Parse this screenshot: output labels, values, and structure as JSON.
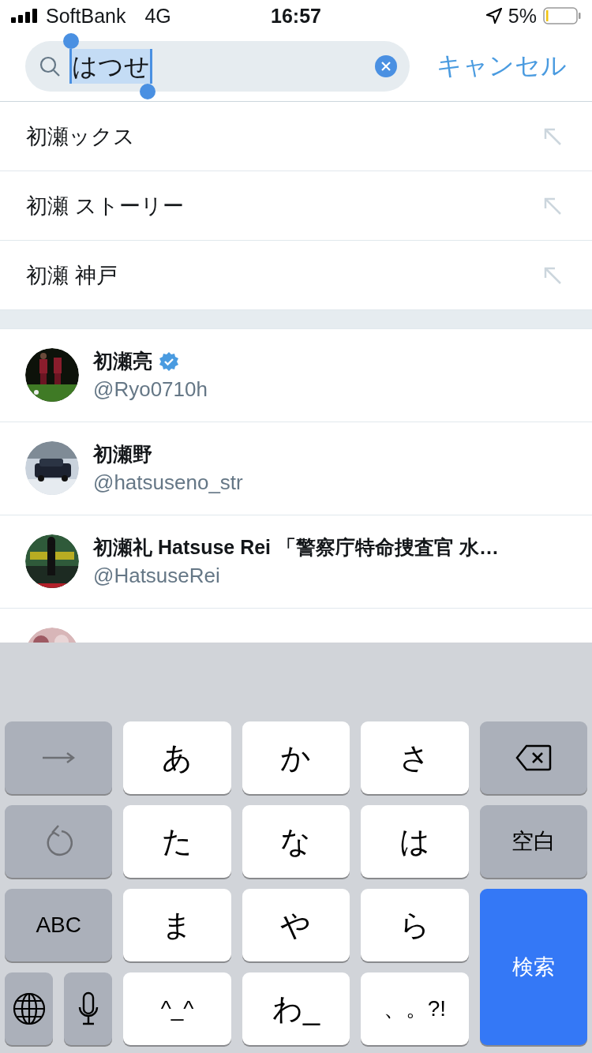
{
  "status_bar": {
    "carrier": "SoftBank",
    "network": "4G",
    "time": "16:57",
    "battery": "5%"
  },
  "search": {
    "value": "はつせ",
    "text_selected": true,
    "cancel": "キャンセル"
  },
  "suggestions": [
    {
      "text": "初瀬ックス"
    },
    {
      "text": "初瀬 ストーリー"
    },
    {
      "text": "初瀬 神戸"
    }
  ],
  "users": [
    {
      "name": "初瀬亮",
      "handle": "@Ryo0710h",
      "verified": true
    },
    {
      "name": "初瀬野",
      "handle": "@hatsuseno_str",
      "verified": false
    },
    {
      "name": "初瀬礼 Hatsuse Rei 「警察庁特命捜査官 水…",
      "handle": "@HatsuseRei",
      "verified": false
    },
    {
      "verified": false
    }
  ],
  "keyboard": {
    "keys": [
      {
        "kind": "next"
      },
      {
        "kind": "char",
        "label": "あ"
      },
      {
        "kind": "char",
        "label": "か"
      },
      {
        "kind": "char",
        "label": "さ"
      },
      {
        "kind": "delete"
      },
      {
        "kind": "undo"
      },
      {
        "kind": "char",
        "label": "た"
      },
      {
        "kind": "char",
        "label": "な"
      },
      {
        "kind": "char",
        "label": "は"
      },
      {
        "kind": "fn",
        "label": "空白"
      },
      {
        "kind": "fn",
        "label": "ABC"
      },
      {
        "kind": "char",
        "label": "ま"
      },
      {
        "kind": "char",
        "label": "や"
      },
      {
        "kind": "char",
        "label": "ら"
      },
      {
        "kind": "search",
        "label": "検索"
      },
      {
        "kind": "globe"
      },
      {
        "kind": "mic"
      },
      {
        "kind": "char",
        "label": "^_^"
      },
      {
        "kind": "char",
        "label": "わ_"
      },
      {
        "kind": "char",
        "label": "、。?!"
      }
    ]
  }
}
